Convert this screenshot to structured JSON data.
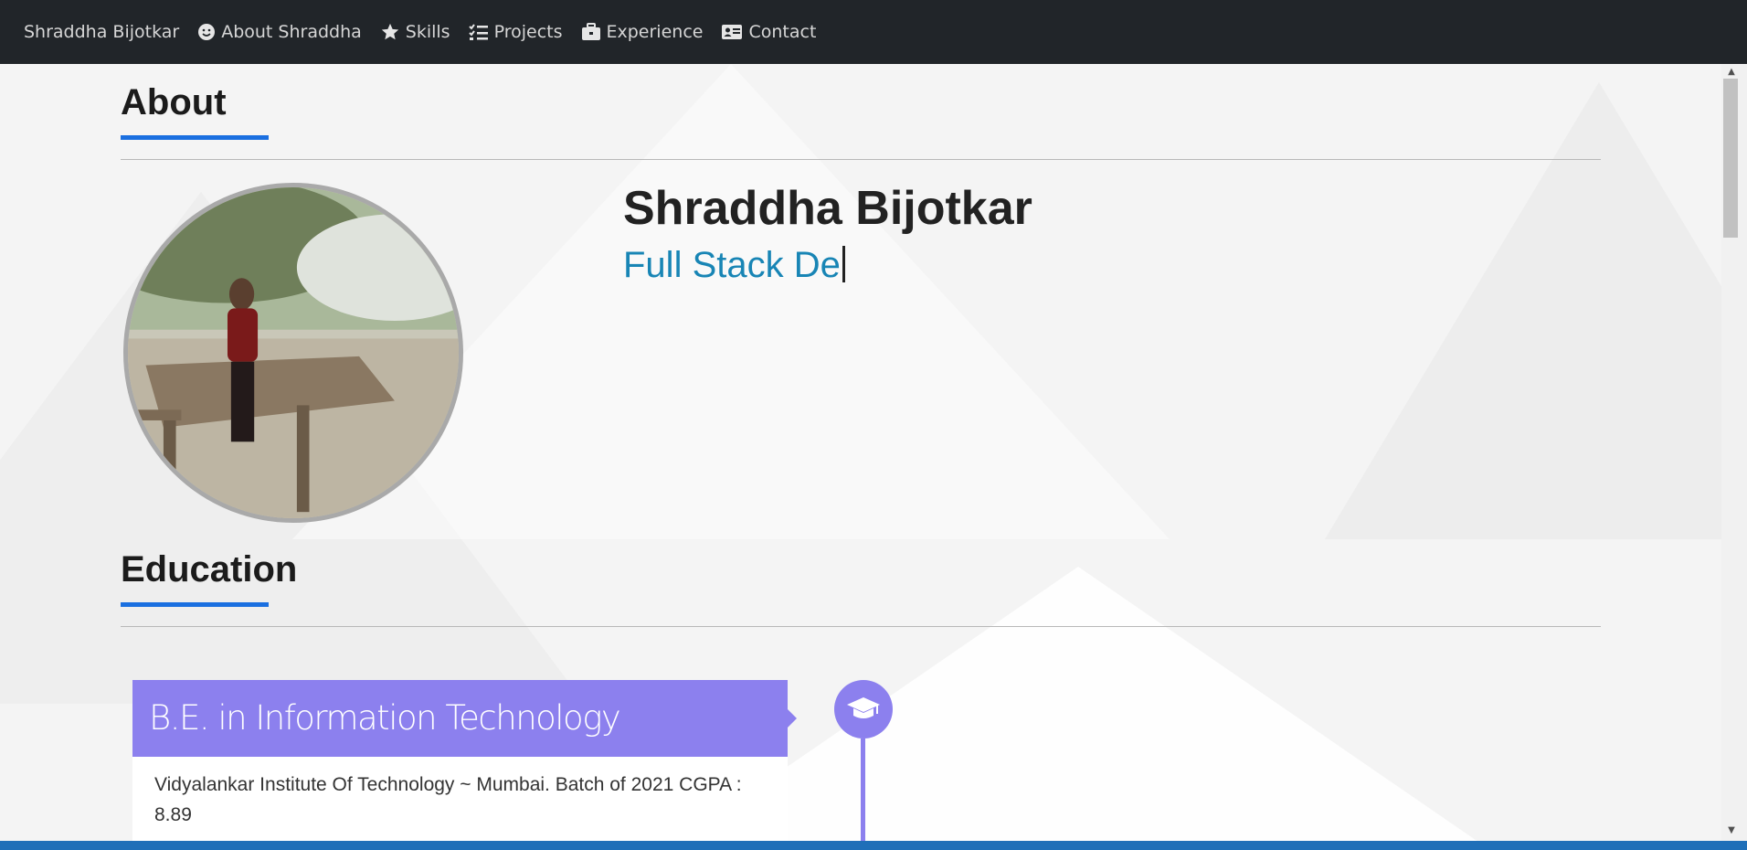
{
  "navbar": {
    "brand": "Shraddha Bijotkar",
    "links": [
      {
        "label": "About Shraddha",
        "icon": "smiley-icon"
      },
      {
        "label": "Skills",
        "icon": "star-icon"
      },
      {
        "label": "Projects",
        "icon": "checklist-icon"
      },
      {
        "label": "Experience",
        "icon": "briefcase-icon"
      },
      {
        "label": "Contact",
        "icon": "contact-card-icon"
      }
    ]
  },
  "about": {
    "heading": "About",
    "name": "Shraddha Bijotkar",
    "role_typed": "Full Stack De"
  },
  "education": {
    "heading": "Education",
    "items": [
      {
        "degree": "B.E. in Information Technology",
        "details": "Vidyalankar Institute Of Technology ~ Mumbai. Batch of 2021 CGPA : 8.89",
        "icon": "graduation-cap-icon"
      }
    ]
  },
  "colors": {
    "navbar_bg": "#212529",
    "accent_underline": "#1a6fe0",
    "role_text": "#1885b5",
    "timeline_purple": "#8c80ee"
  }
}
